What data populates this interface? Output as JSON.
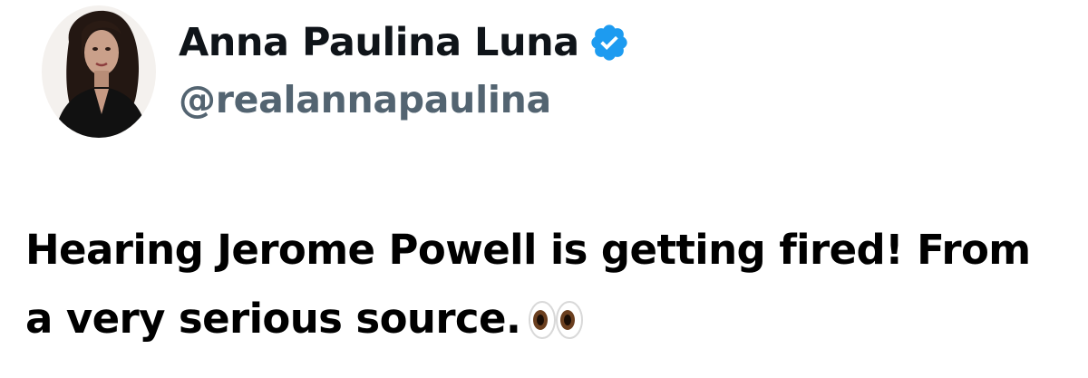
{
  "author": {
    "display_name": "Anna Paulina Luna",
    "handle": "@realannapaulina",
    "verified": true,
    "verified_color": "#1d9bf0",
    "avatar_icon": "profile-photo"
  },
  "tweet": {
    "line1": "Hearing Jerome Powell is getting fired!   From",
    "line2": "a very serious source.",
    "emoji": "eyes-icon"
  },
  "colors": {
    "text": "#0f1419",
    "handle": "#536471"
  }
}
